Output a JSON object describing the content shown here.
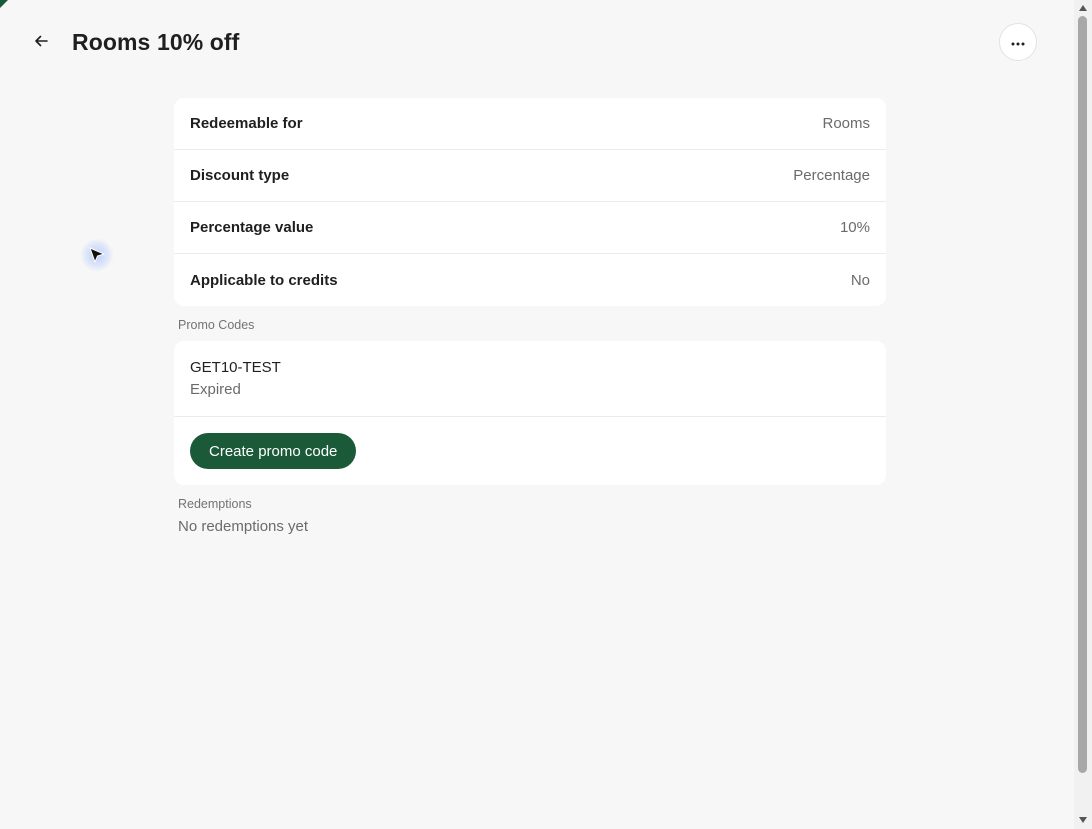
{
  "header": {
    "title": "Rooms 10% off",
    "back_icon": "arrow-left-icon",
    "more_icon": "more-horizontal-icon"
  },
  "details": [
    {
      "label": "Redeemable for",
      "value": "Rooms"
    },
    {
      "label": "Discount type",
      "value": "Percentage"
    },
    {
      "label": "Percentage value",
      "value": "10%"
    },
    {
      "label": "Applicable to credits",
      "value": "No"
    }
  ],
  "promo_codes": {
    "section_label": "Promo Codes",
    "items": [
      {
        "code": "GET10-TEST",
        "status": "Expired"
      }
    ],
    "create_label": "Create promo code"
  },
  "redemptions": {
    "section_label": "Redemptions",
    "empty_text": "No redemptions yet"
  },
  "colors": {
    "accent": "#1b5a38",
    "background": "#f7f7f7",
    "card": "#ffffff",
    "muted_text": "#6b6b6b"
  }
}
